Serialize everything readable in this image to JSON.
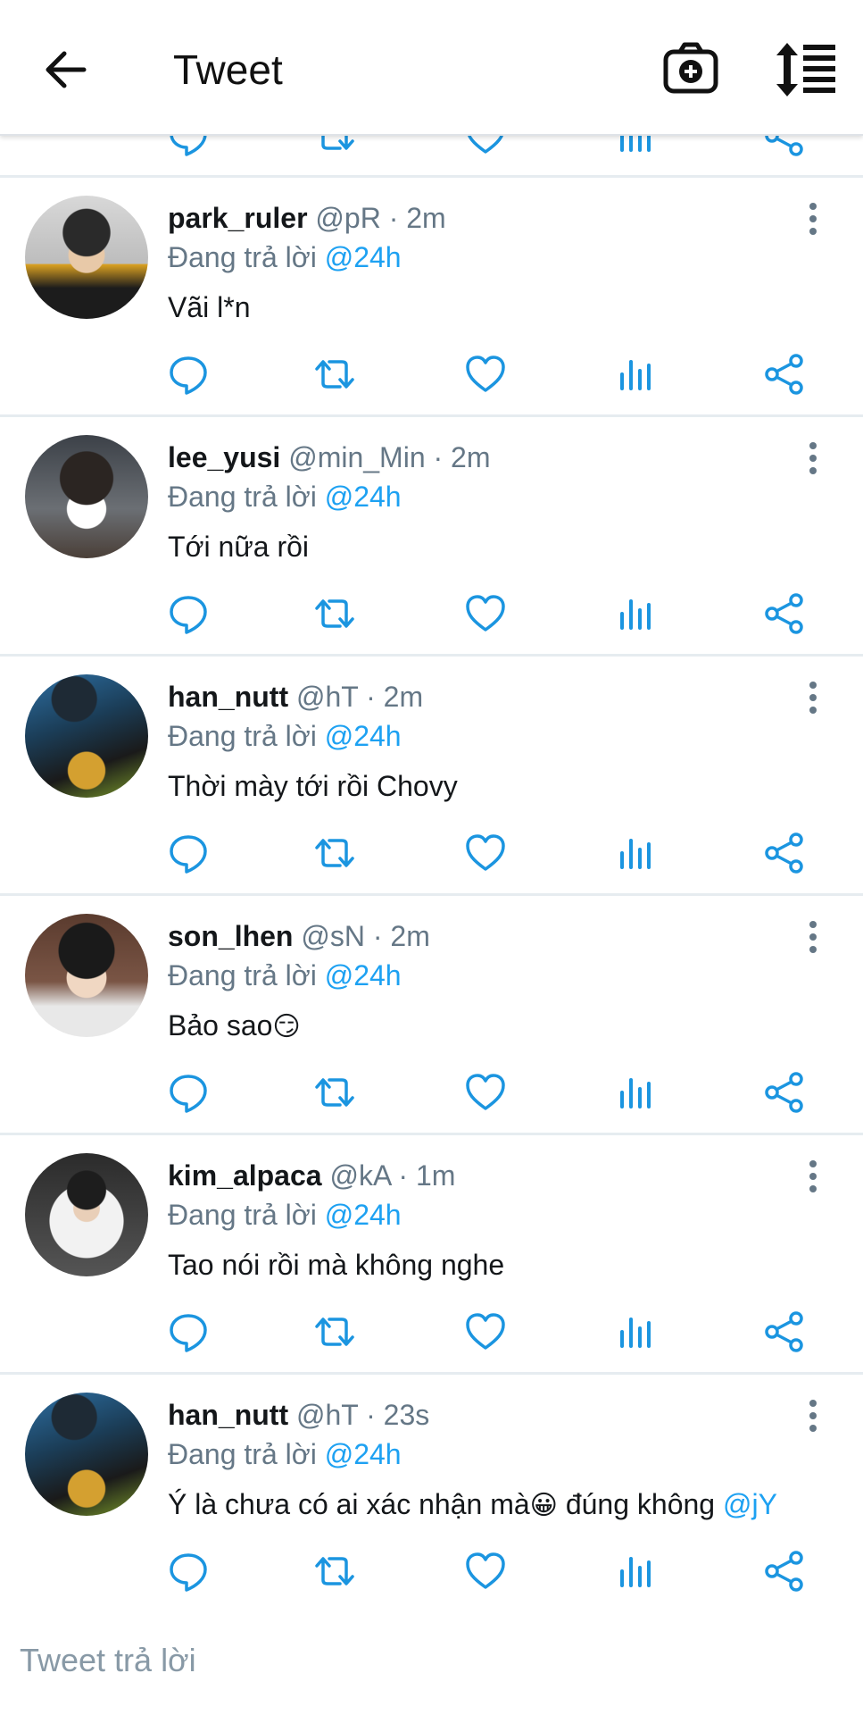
{
  "header": {
    "title": "Tweet"
  },
  "tweets": [
    {
      "username": "park_ruler",
      "handle": "@pR",
      "time": "2m",
      "reply_prefix": "Đang trả lời",
      "reply_to": "@24h",
      "text": "Vãi l*n",
      "text_emoji": "",
      "text_suffix": "",
      "mention": ""
    },
    {
      "username": "lee_yusi",
      "handle": "@min_Min",
      "time": "2m",
      "reply_prefix": "Đang trả lời",
      "reply_to": "@24h",
      "text": "Tới nữa rồi",
      "text_emoji": "",
      "text_suffix": "",
      "mention": ""
    },
    {
      "username": "han_nutt",
      "handle": "@hT",
      "time": "2m",
      "reply_prefix": "Đang trả lời",
      "reply_to": "@24h",
      "text": "Thời mày tới rồi Chovy",
      "text_emoji": "",
      "text_suffix": "",
      "mention": ""
    },
    {
      "username": "son_lhen",
      "handle": "@sN",
      "time": "2m",
      "reply_prefix": "Đang trả lời",
      "reply_to": "@24h",
      "text": "Bảo sao",
      "text_emoji": "😏",
      "text_suffix": "",
      "mention": ""
    },
    {
      "username": "kim_alpaca",
      "handle": "@kA",
      "time": "1m",
      "reply_prefix": "Đang trả lời",
      "reply_to": "@24h",
      "text": "Tao nói rồi mà không nghe",
      "text_emoji": "",
      "text_suffix": "",
      "mention": ""
    },
    {
      "username": "han_nutt",
      "handle": "@hT",
      "time": "23s",
      "reply_prefix": "Đang trả lời",
      "reply_to": "@24h",
      "text": "Ý là chưa có ai xác nhận mà",
      "text_emoji": "😀",
      "text_suffix": " đúng không ",
      "mention": "@jY"
    }
  ],
  "composer": {
    "placeholder": "Tweet trả lời"
  },
  "icons": {
    "back": "arrow-left-icon",
    "camera": "camera-plus-icon",
    "sort": "sort-list-icon",
    "reply": "reply-bubble-icon",
    "retweet": "retweet-icon",
    "like": "heart-icon",
    "stats": "stats-bars-icon",
    "share": "share-icon",
    "more": "more-vertical-icon"
  },
  "colors": {
    "accent": "#1da1f2",
    "secondary_text": "#657786",
    "icon": "#1b95e0"
  }
}
